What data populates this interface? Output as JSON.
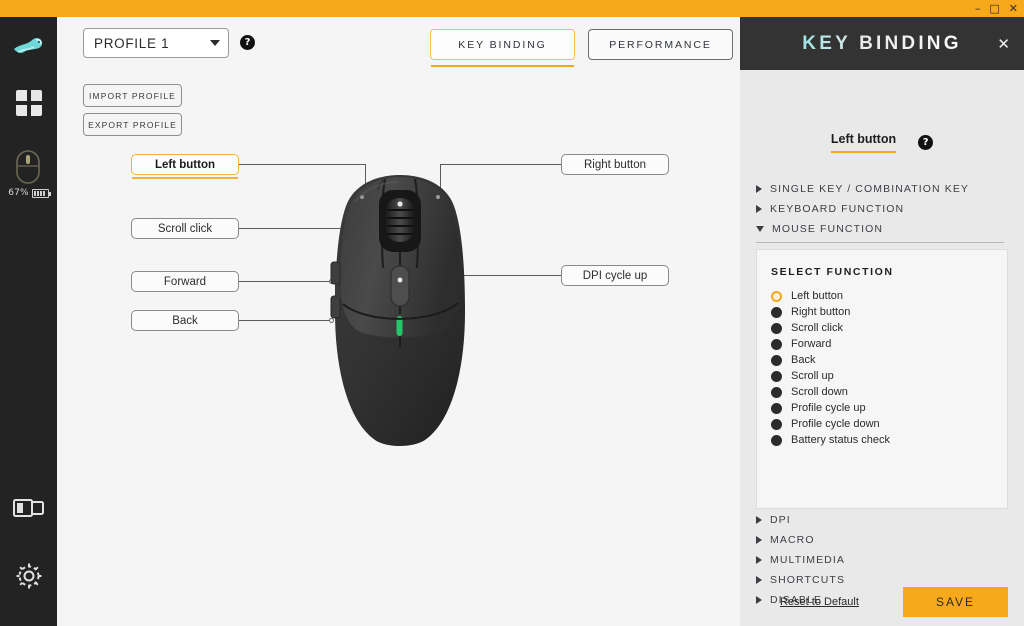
{
  "titlebar": {
    "minimize": "–",
    "maximize": "□",
    "close": "✕",
    "accent_color": "#f7a81b"
  },
  "sidebar": {
    "logo_name": "pegasus-logo",
    "items": [
      {
        "name": "devices-grid-icon",
        "label": ""
      },
      {
        "name": "mouse-device-icon",
        "label": ""
      }
    ],
    "battery": {
      "percent": "67%",
      "icon": "battery-icon"
    },
    "bottom_items": [
      {
        "name": "dock-icon",
        "label": ""
      },
      {
        "name": "settings-gear-icon",
        "label": ""
      }
    ]
  },
  "toolbar": {
    "profile_value": "PROFILE 1",
    "profile_options": [
      "PROFILE 1"
    ],
    "help_glyph": "?",
    "import_label": "IMPORT PROFILE",
    "export_label": "EXPORT PROFILE"
  },
  "tabs": [
    {
      "label": "KEY BINDING",
      "active": true
    },
    {
      "label": "PERFORMANCE",
      "active": false
    }
  ],
  "mouse_map": {
    "left_labels": [
      {
        "label": "Left button",
        "selected": true
      },
      {
        "label": "Scroll click",
        "selected": false
      },
      {
        "label": "Forward",
        "selected": false
      },
      {
        "label": "Back",
        "selected": false
      }
    ],
    "right_labels": [
      {
        "label": "Right button",
        "selected": false
      },
      {
        "label": "DPI cycle up",
        "selected": false
      }
    ]
  },
  "panel": {
    "title": "KEY BINDING",
    "close_glyph": "✕",
    "current_button": "Left button",
    "help_glyph": "?",
    "accordions_top": [
      {
        "label": "SINGLE KEY / COMBINATION KEY",
        "expanded": false
      },
      {
        "label": "KEYBOARD FUNCTION",
        "expanded": false
      },
      {
        "label": "MOUSE FUNCTION",
        "expanded": true
      }
    ],
    "select_function_title": "SELECT FUNCTION",
    "functions": [
      {
        "label": "Left button",
        "selected": true
      },
      {
        "label": "Right button",
        "selected": false
      },
      {
        "label": "Scroll click",
        "selected": false
      },
      {
        "label": "Forward",
        "selected": false
      },
      {
        "label": "Back",
        "selected": false
      },
      {
        "label": "Scroll up",
        "selected": false
      },
      {
        "label": "Scroll down",
        "selected": false
      },
      {
        "label": "Profile cycle up",
        "selected": false
      },
      {
        "label": "Profile cycle down",
        "selected": false
      },
      {
        "label": "Battery status check",
        "selected": false
      }
    ],
    "accordions_bottom": [
      {
        "label": "DPI",
        "expanded": false
      },
      {
        "label": "MACRO",
        "expanded": false
      },
      {
        "label": "MULTIMEDIA",
        "expanded": false
      },
      {
        "label": "SHORTCUTS",
        "expanded": false
      },
      {
        "label": "DISABLE",
        "expanded": false
      }
    ],
    "reset_label": "Reset to Default",
    "save_label": "SAVE",
    "save_color": "#f7a81b"
  }
}
